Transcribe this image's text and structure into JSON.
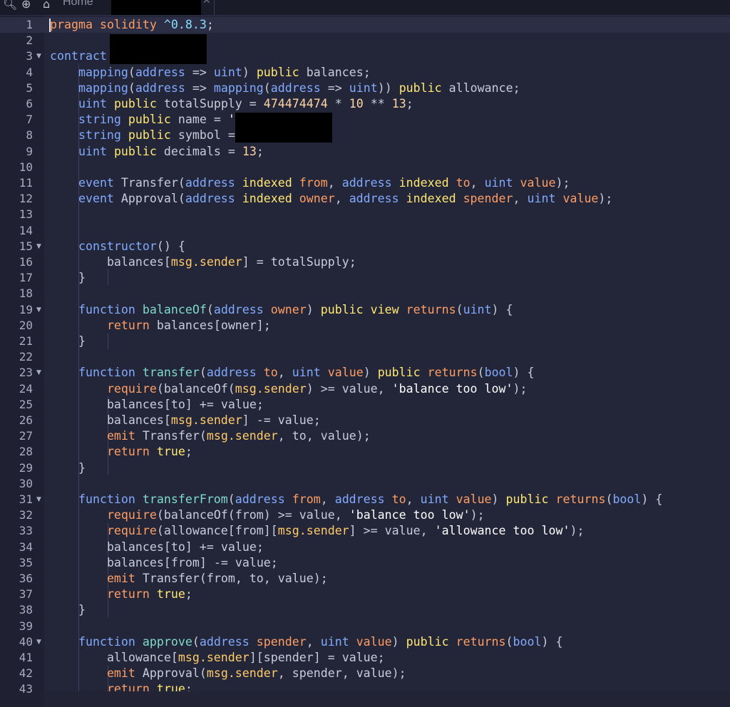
{
  "toolbar": {
    "zoom_out_icon": "zoom-out-icon",
    "zoom_in_icon": "zoom-in-icon",
    "home_icon": "home-icon",
    "home_label": "Home",
    "close_glyph": "✕"
  },
  "editor": {
    "language": "solidity",
    "line_numbers": [
      "1",
      "2",
      "3",
      "4",
      "5",
      "6",
      "7",
      "8",
      "9",
      "10",
      "11",
      "12",
      "13",
      "14",
      "15",
      "16",
      "17",
      "18",
      "19",
      "20",
      "21",
      "22",
      "23",
      "24",
      "25",
      "26",
      "27",
      "28",
      "29",
      "30",
      "31",
      "32",
      "33",
      "34",
      "35",
      "36",
      "37",
      "38",
      "39",
      "40",
      "41",
      "42",
      "43"
    ],
    "fold_markers": [
      "3",
      "15",
      "19",
      "23",
      "31",
      "40"
    ],
    "lines": [
      "pragma solidity ^0.8.3;",
      "",
      "contract ",
      "    mapping(address => uint) public balances;",
      "    mapping(address => mapping(address => uint)) public allowance;",
      "    uint public totalSupply = 474474474 * 10 ** 13;",
      "    string public name = '",
      "    string public symbol = ",
      "    uint public decimals = 13;",
      "",
      "    event Transfer(address indexed from, address indexed to, uint value);",
      "    event Approval(address indexed owner, address indexed spender, uint value);",
      "",
      "",
      "    constructor() {",
      "        balances[msg.sender] = totalSupply;",
      "    }",
      "",
      "    function balanceOf(address owner) public view returns(uint) {",
      "        return balances[owner];",
      "    }",
      "",
      "    function transfer(address to, uint value) public returns(bool) {",
      "        require(balanceOf(msg.sender) >= value, 'balance too low');",
      "        balances[to] += value;",
      "        balances[msg.sender] -= value;",
      "        emit Transfer(msg.sender, to, value);",
      "        return true;",
      "    }",
      "",
      "    function transferFrom(address from, address to, uint value) public returns(bool) {",
      "        require(balanceOf(from) >= value, 'balance too low');",
      "        require(allowance[from][msg.sender] >= value, 'allowance too low');",
      "        balances[to] += value;",
      "        balances[from] -= value;",
      "        emit Transfer(from, to, value);",
      "        return true;",
      "    }",
      "",
      "    function approve(address spender, uint value) public returns(bool) {",
      "        allowance[msg.sender][spender] = value;",
      "        emit Approval(msg.sender, spender, value);",
      "        return true;"
    ]
  },
  "colors": {
    "background": "#232538",
    "gutter": "#1f2133",
    "keyword_blue": "#82aaff",
    "modifier_yellow": "#ffe873",
    "param_orange": "#ff9e64",
    "redaction": "#000000"
  }
}
